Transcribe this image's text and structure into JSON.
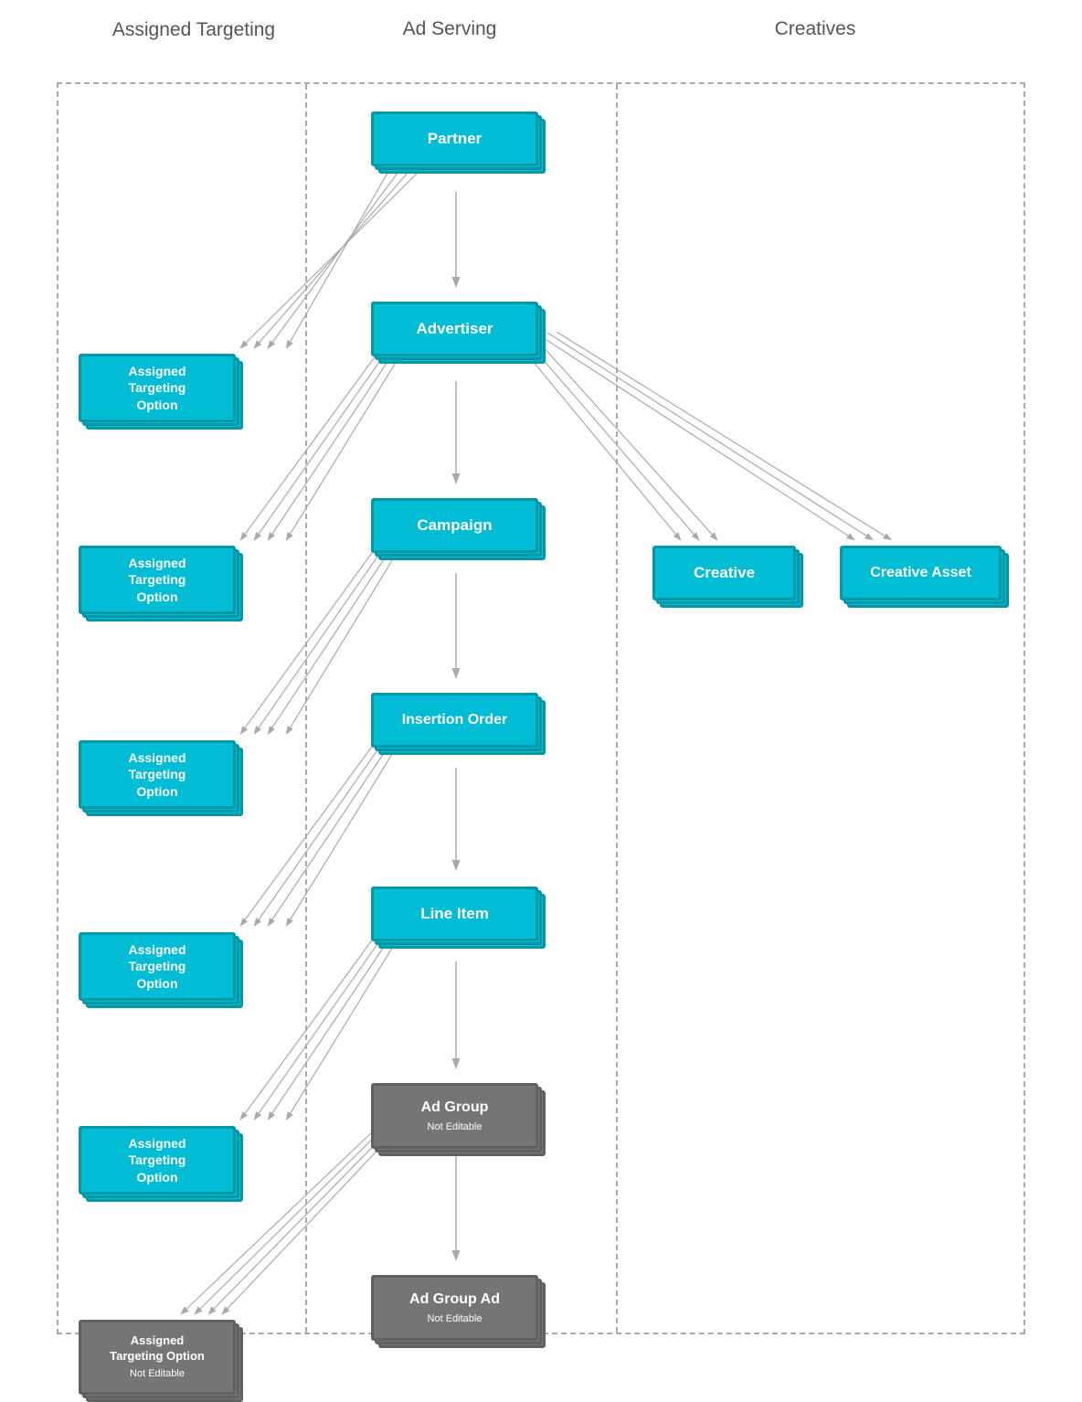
{
  "headers": {
    "assigned_targeting": "Assigned\nTargeting",
    "ad_serving": "Ad Serving",
    "creatives": "Creatives"
  },
  "nodes": {
    "partner": "Partner",
    "advertiser": "Advertiser",
    "campaign": "Campaign",
    "insertion_order": "Insertion Order",
    "line_item": "Line Item",
    "ad_group": "Ad Group",
    "ad_group_not_editable": "Not Editable",
    "ad_group_ad": "Ad Group Ad",
    "ad_group_ad_not_editable": "Not Editable",
    "creative": "Creative",
    "creative_asset": "Creative Asset",
    "assigned_targeting_option": "Assigned\nTargeting\nOption",
    "not_editable": "Not Editable"
  }
}
